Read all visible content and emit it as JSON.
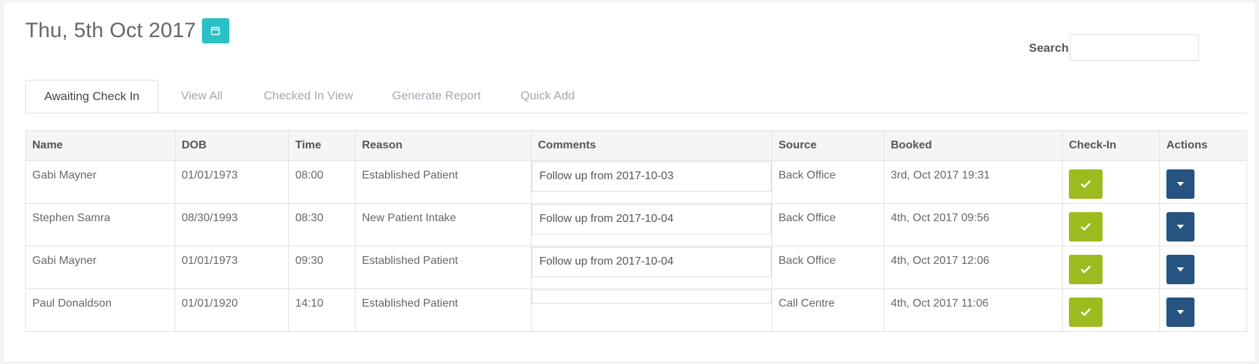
{
  "header": {
    "date_title": "Thu, 5th Oct 2017",
    "calendar_icon": "calendar-icon"
  },
  "search": {
    "label": "Search",
    "value": "",
    "placeholder": ""
  },
  "tabs": [
    {
      "label": "Awaiting Check In",
      "active": true
    },
    {
      "label": "View All",
      "active": false
    },
    {
      "label": "Checked In View",
      "active": false
    },
    {
      "label": "Generate Report",
      "active": false
    },
    {
      "label": "Quick Add",
      "active": false
    }
  ],
  "table": {
    "columns": [
      "Name",
      "DOB",
      "Time",
      "Reason",
      "Comments",
      "Source",
      "Booked",
      "Check-In",
      "Actions"
    ],
    "rows": [
      {
        "name": "Gabi Mayner",
        "dob": "01/01/1973",
        "time": "08:00",
        "reason": "Established Patient",
        "comment": "Follow up from 2017-10-03",
        "source": "Back Office",
        "booked": "3rd, Oct 2017 19:31"
      },
      {
        "name": "Stephen Samra",
        "dob": "08/30/1993",
        "time": "08:30",
        "reason": "New Patient Intake",
        "comment": "Follow up from 2017-10-04",
        "source": "Back Office",
        "booked": "4th, Oct 2017 09:56"
      },
      {
        "name": "Gabi Mayner",
        "dob": "01/01/1973",
        "time": "09:30",
        "reason": "Established Patient",
        "comment": "Follow up from 2017-10-04",
        "source": "Back Office",
        "booked": "4th, Oct 2017 12:06"
      },
      {
        "name": "Paul Donaldson",
        "dob": "01/01/1920",
        "time": "14:10",
        "reason": "Established Patient",
        "comment": "",
        "source": "Call Centre",
        "booked": "4th, Oct 2017 11:06"
      }
    ]
  },
  "colors": {
    "calendar_button": "#2bc0c6",
    "check_in_button": "#9dbb1f",
    "actions_button": "#265380"
  }
}
